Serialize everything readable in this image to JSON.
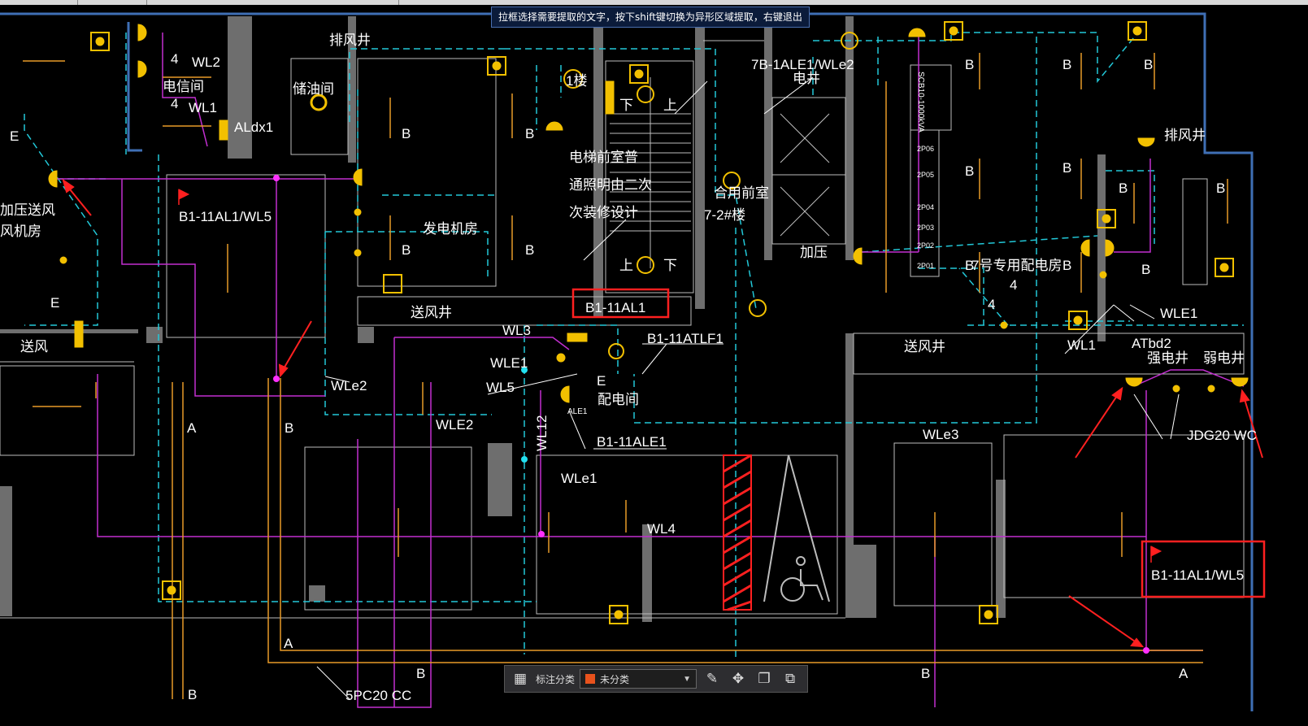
{
  "tooltip": "拉框选择需要提取的文字，按下shift键切换为异形区域提取，右键退出",
  "colors": {
    "background": "#000000",
    "wall": "#7a7a7a",
    "boundary": "#3f6fb5",
    "dashed_circuit": "#22c8d8",
    "magenta_circuit": "#c22fd0",
    "fixture": "#f2c000",
    "orange_line": "#e79a28",
    "annotation_red": "#ff2020",
    "text": "#ffffff",
    "category_swatch": "#e8521c"
  },
  "cad_labels": {
    "wl2": "WL2",
    "wl1_top": "WL1",
    "num4a": "4",
    "num4b": "4",
    "aldx1": "ALdx1",
    "dianxinjian": "电信间",
    "chuyoujian": "储油间",
    "paifengjing": "排风井",
    "e_left": "E",
    "jiaya_songfeng": "加压送风",
    "fengjifang": "风机房",
    "b1_11al1_wl5_left": "B1-11AL1/WL5",
    "songfeng_left": "送风",
    "e_left2": "E",
    "fadianjifang": "发电机房",
    "b_a": "B",
    "b_b": "B",
    "b_c": "B",
    "b_d": "B",
    "b_e": "B",
    "yiji": "1楼",
    "note_line1": "电梯前室普",
    "note_line2": "通照明由二次",
    "note_line3": "次装修设计",
    "hehe_qianshi": "合用前室",
    "floor72": "7-2#楼",
    "label_7b": "7B-1ALE1/WLe2",
    "diantijing": "电井",
    "jiaya": "加压",
    "songfengjing_mid": "送风井",
    "b1_11al1": "B1-11AL1",
    "wl3": "WL3",
    "wle1_mid": "WLE1",
    "wl5_mid": "WL5",
    "b1_11atlf1": "B1-11ATLF1",
    "peidianjian": "配电间",
    "e_mid": "E",
    "ale1": "ALE1",
    "wle2_mid": "WLe2",
    "wle2_low": "WLE2",
    "wl12": "WL12",
    "b1_11ale1": "B1-11ALE1",
    "wle1_low": "WLe1",
    "wl4": "WL4",
    "b_mid": "B",
    "a_left": "A",
    "a_left_low": "A",
    "b_left_low": "B",
    "b_bottom_mid": "B",
    "b_bottom_left": "B",
    "pipe": "5PC20 CC",
    "songfengjing_right": "送风井",
    "wle3": "WLe3",
    "zhuanyong_peidianfang": "7号专用配电房",
    "num4c": "4",
    "num4d": "4",
    "wl1_right": "WL1",
    "wle1_right": "WLE1",
    "atbd2": "ATbd2",
    "qiangdianjing": "强电井",
    "ruodianjing": "弱电井",
    "jdg20": "JDG20 WC",
    "paifengjing_right": "排风井",
    "b1_11al1_wl5_right": "B1-11AL1/WL5",
    "b_r1": "B",
    "b_r2": "B",
    "b_r3": "B",
    "b_r4": "B",
    "b_r5": "B",
    "b_r6": "B",
    "b_r7": "B",
    "b_r8": "B",
    "b_r9": "B",
    "b_r10": "B",
    "b_bottom_right": "B",
    "a_bottom_right": "A",
    "panel_text": "SCB10-1000kVA",
    "breaker_1": "2P06",
    "breaker_2": "2P05",
    "breaker_3": "2P04",
    "breaker_4": "2P03",
    "breaker_5": "2P02",
    "breaker_6": "2P01",
    "xiang": "下",
    "shang": "上"
  },
  "toolbar": {
    "grid_icon": "grid-icon",
    "label": "标注分类",
    "select_value": "未分类",
    "edit_icon": "edit-icon",
    "move_icon": "move-icon",
    "copy_icon": "copy-icon",
    "paste_icon": "paste-icon"
  }
}
